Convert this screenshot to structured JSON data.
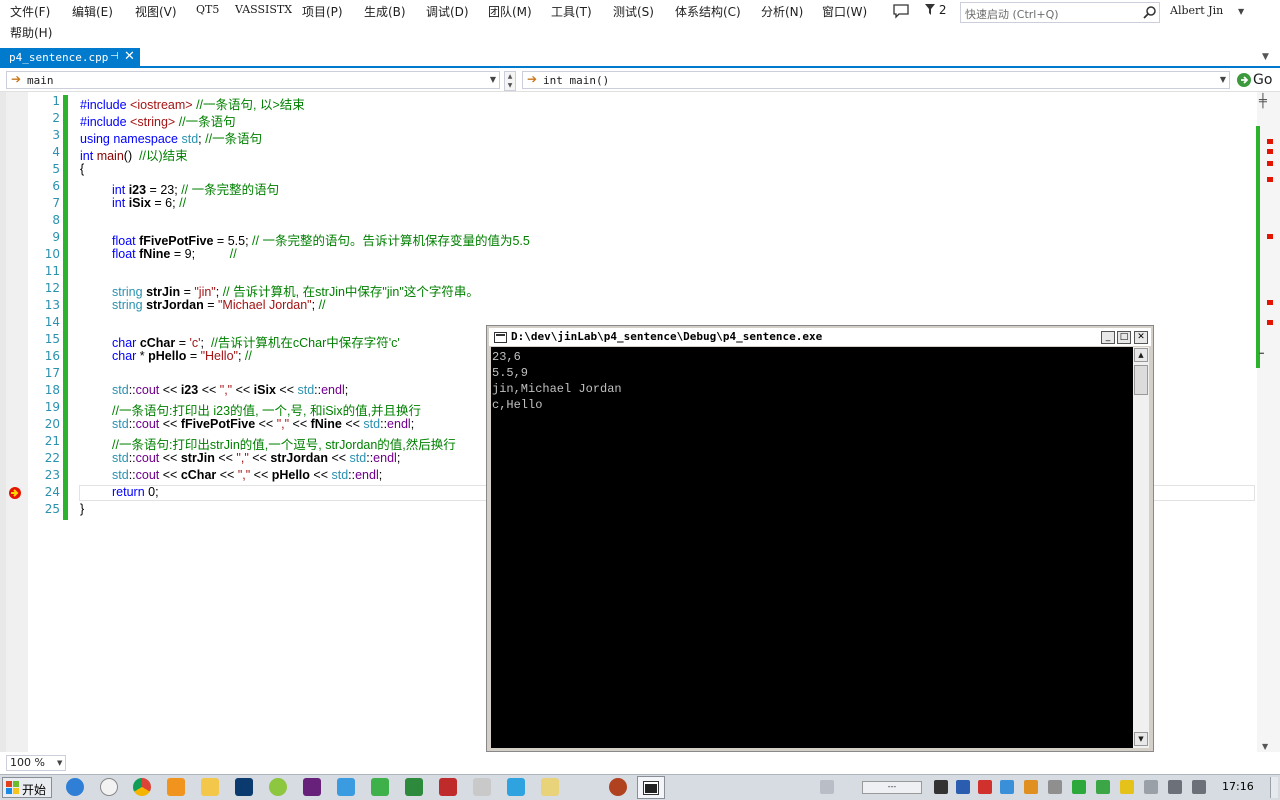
{
  "menu": {
    "row1": [
      "文件(F)",
      "编辑(E)",
      "视图(V)",
      "QT5",
      "VASSISTX",
      "项目(P)",
      "生成(B)",
      "调试(D)",
      "团队(M)",
      "工具(T)",
      "测试(S)",
      "体系结构(C)",
      "分析(N)",
      "窗口(W)"
    ],
    "row2": [
      "帮助(H)"
    ],
    "filter_count": "2",
    "quick_launch_placeholder": "快速启动 (Ctrl+Q)",
    "user": "Albert Jin"
  },
  "tab": {
    "title": "p4_sentence.cpp",
    "pin": "⊣",
    "close": "✕"
  },
  "navbar": {
    "scope": "main",
    "member": "int main()",
    "go_label": "Go"
  },
  "editor": {
    "zoom": "100 %",
    "current_line": 24,
    "line_numbers": [
      "1",
      "2",
      "3",
      "4",
      "5",
      "6",
      "7",
      "8",
      "9",
      "10",
      "11",
      "12",
      "13",
      "14",
      "15",
      "16",
      "17",
      "18",
      "19",
      "20",
      "21",
      "22",
      "23",
      "24",
      "25"
    ],
    "lines": [
      "#include <iostream> //一条语句, 以>结束",
      "#include <string> //一条语句",
      "using namespace std; //一条语句",
      "int main()  //以)结束",
      "{",
      "int i23 = 23; // 一条完整的语句",
      "int iSix = 6; //",
      "",
      "float fFivePotFive = 5.5; // 一条完整的语句。告诉计算机保存变量的值为5.5",
      "float fNine = 9;          //",
      "",
      "string strJin = \"jin\"; // 告诉计算机, 在strJin中保存\"jin\"这个字符串。",
      "string strJordan = \"Michael Jordan\"; //",
      "",
      "char cChar = 'c';  //告诉计算机在cChar中保存字符'c'",
      "char * pHello = \"Hello\"; //",
      "",
      "std::cout << i23 << \",\" << iSix << std::endl;",
      "//一条语句:打印出 i23的值, 一个,号, 和iSix的值,并且换行",
      "std::cout << fFivePotFive << \",\" << fNine << std::endl;",
      "//一条语句:打印出strJin的值,一个逗号, strJordan的值,然后换行",
      "std::cout << strJin << \",\" << strJordan << std::endl;",
      "std::cout << cChar << \",\" << pHello << std::endl;",
      "return 0;",
      "}"
    ]
  },
  "console": {
    "title": "D:\\dev\\jinLab\\p4_sentence\\Debug\\p4_sentence.exe",
    "output": [
      "23,6",
      "5.5,9",
      "jin,Michael Jordan",
      "c,Hello"
    ]
  },
  "taskbar": {
    "start_label": "开始",
    "clock": "17:16",
    "ime_indicator": "---"
  },
  "colors": {
    "accent": "#007acc",
    "keyword": "#0000ff",
    "type": "#2b91af",
    "string": "#a31515",
    "comment": "#008000",
    "change_bar": "#2db22d",
    "error_mark": "#e51400",
    "console_bg": "#000000",
    "console_text": "#c0c0c0"
  }
}
